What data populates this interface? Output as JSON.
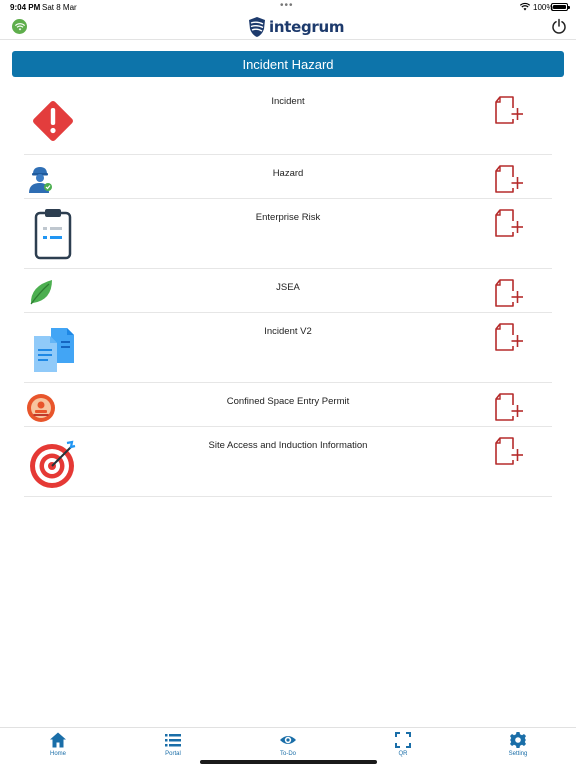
{
  "status_bar": {
    "time": "9:04 PM",
    "date": "Sat 8 Mar",
    "dots": "•••",
    "battery_pct": "100%"
  },
  "header": {
    "logo_text": "integrum",
    "connection_icon": "wifi-icon",
    "power_icon": "power-icon"
  },
  "page": {
    "title": "Incident Hazard"
  },
  "forms": [
    {
      "label": "Incident",
      "icon": "warning-diamond-icon"
    },
    {
      "label": "Hazard",
      "icon": "worker-icon"
    },
    {
      "label": "Enterprise Risk",
      "icon": "clipboard-icon"
    },
    {
      "label": "JSEA",
      "icon": "leaf-icon"
    },
    {
      "label": "Incident V2",
      "icon": "documents-icon"
    },
    {
      "label": "Confined Space Entry Permit",
      "icon": "stamp-icon"
    },
    {
      "label": "Site Access and Induction Information",
      "icon": "target-icon"
    }
  ],
  "tab_bar": {
    "tabs": [
      {
        "label": "Home",
        "icon": "home-icon"
      },
      {
        "label": "Portal",
        "icon": "list-icon"
      },
      {
        "label": "To-Do",
        "icon": "eye-icon"
      },
      {
        "label": "QR",
        "icon": "qr-scan-icon"
      },
      {
        "label": "Setting",
        "icon": "gear-icon"
      }
    ]
  },
  "colors": {
    "title_bar": "#0d74aa",
    "add_icon": "#b52b2b",
    "tab_accent": "#1a6ea8"
  }
}
